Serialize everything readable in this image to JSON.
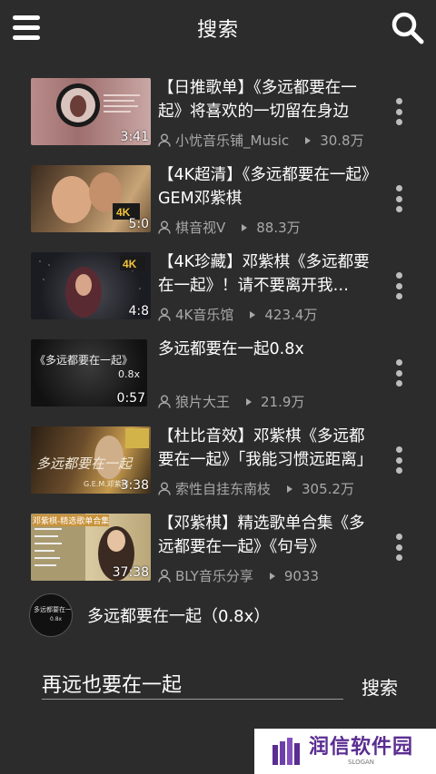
{
  "header": {
    "title": "搜索"
  },
  "videos": [
    {
      "title": "【日推歌单】《多远都要在一起》将喜欢的一切留在身边",
      "uploader": "小忧音乐铺_Music",
      "views": "30.8万",
      "duration": "3:41"
    },
    {
      "title": "【4K超清】《多远都要在一起》GEM邓紫棋",
      "uploader": "棋音视V",
      "views": "88.3万",
      "duration": "5:0"
    },
    {
      "title": "【4K珍藏】邓紫棋《多远都要在一起》！请不要离开我…",
      "uploader": "4K音乐馆",
      "views": "423.4万",
      "duration": "4:8"
    },
    {
      "title": "多远都要在一起0.8x",
      "uploader": "狼片大王",
      "views": "21.9万",
      "duration": "0:57"
    },
    {
      "title": "【杜比音效】邓紫棋《多远都要在一起》「我能习惯远距离」",
      "uploader": "索性自挂东南枝",
      "views": "305.2万",
      "duration": "3:38"
    },
    {
      "title": "【邓紫棋】精选歌单合集《多远都要在一起》《句号》",
      "uploader": "BLY音乐分享",
      "views": "9033",
      "duration": "37:38"
    }
  ],
  "thumb_text": {
    "t4_line1": "《多远都要在一起》",
    "t4_line2": "0.8x",
    "t5_text": "多远都要在一起",
    "t5_sig": "G.E.M.邓紫棋",
    "t6_title": "邓紫棋-精选歌单合集"
  },
  "suggestion": {
    "text": "多远都要在一起（0.8x）",
    "avatar_line1": "多远都要在一起",
    "avatar_line2": "0.8x"
  },
  "search": {
    "value": "再远也要在一起",
    "button_label": "搜索"
  },
  "brand": {
    "name": "润信软件园",
    "slogan": "SLOGAN"
  }
}
